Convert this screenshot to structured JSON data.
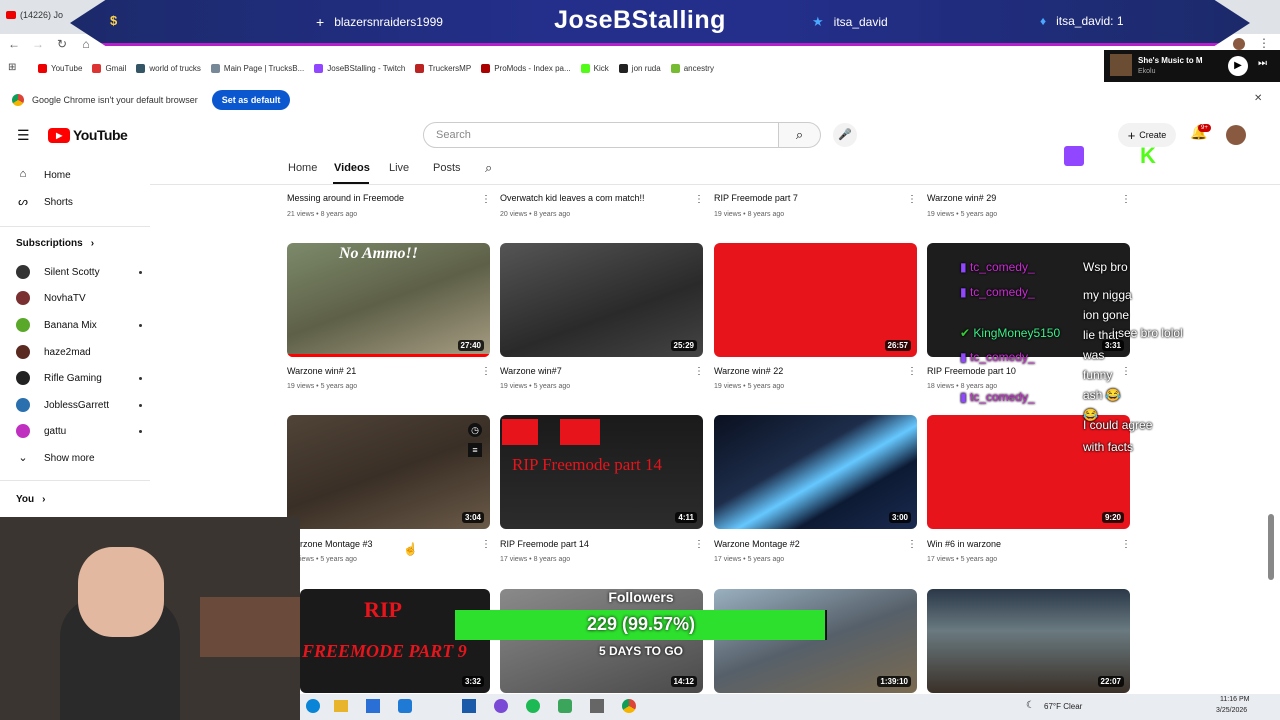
{
  "browser": {
    "tab_title": "(14226) Jo",
    "bookmarks": [
      "YouTube",
      "Gmail",
      "world of trucks",
      "Main Page | TrucksB...",
      "JoseBStalling - Twitch",
      "TruckersMP",
      "ProMods - Index pa...",
      "Kick",
      "jon ruda",
      "ancestry"
    ],
    "default_msg": "Google Chrome isn't your default browser",
    "set_default": "Set as default",
    "close": "✕"
  },
  "overlay": {
    "streamer": "JoseBStalling",
    "left_user": "blazersnraiders1999",
    "right_user": "itsa_david",
    "right_count": "itsa_david: 1",
    "colors": {
      "banner": "#232f8a",
      "accent": "#b620c9",
      "goal": "#2ee02e"
    }
  },
  "music": {
    "title": "She's Music to M",
    "artist": "Ekolu"
  },
  "youtube": {
    "logo": "YouTube",
    "search_placeholder": "Search",
    "create": "Create",
    "notif_badge": "9+",
    "sidebar": {
      "home": "Home",
      "shorts": "Shorts",
      "subs_header": "Subscriptions",
      "subs": [
        {
          "name": "Silent Scotty",
          "color": "#333"
        },
        {
          "name": "NovhaTV",
          "color": "#7a3030"
        },
        {
          "name": "Banana Mix",
          "color": "#5aa82a"
        },
        {
          "name": "haze2mad",
          "color": "#5a2a20"
        },
        {
          "name": "Rifle Gaming",
          "color": "#222"
        },
        {
          "name": "JoblessGarrett",
          "color": "#2a6fae"
        },
        {
          "name": "gattu",
          "color": "#c030c0"
        }
      ],
      "show_more": "Show more",
      "you": "You"
    },
    "tabs": [
      "Home",
      "Videos",
      "Live",
      "Posts"
    ],
    "row0": [
      {
        "title": "Messing around in Freemode",
        "meta": "21 views • 8 years ago"
      },
      {
        "title": "Overwatch kid leaves a com match!!",
        "meta": "20 views • 8 years ago"
      },
      {
        "title": "RIP Freemode part 7",
        "meta": "19 views • 8 years ago"
      },
      {
        "title": "Warzone win# 29",
        "meta": "19 views • 5 years ago"
      }
    ],
    "row1": [
      {
        "title": "Warzone win# 21",
        "meta": "19 views • 5 years ago",
        "dur": "27:40",
        "overlay": "No Ammo!!"
      },
      {
        "title": "Warzone win#7",
        "meta": "19 views • 5 years ago",
        "dur": "25:29"
      },
      {
        "title": "Warzone win# 22",
        "meta": "19 views • 5 years ago",
        "dur": "26:57"
      },
      {
        "title": "RIP Freemode part 10",
        "meta": "18 views • 8 years ago",
        "dur": "3:31"
      }
    ],
    "row2": [
      {
        "title": "rzone Montage #3",
        "meta": "iews • 5 years ago",
        "dur": "3:04"
      },
      {
        "title": "RIP Freemode part 14",
        "meta": "17 views • 8 years ago",
        "dur": "4:11",
        "overlay": "RIP Freemode part 14"
      },
      {
        "title": "Warzone Montage #2",
        "meta": "17 views • 5 years ago",
        "dur": "3:00"
      },
      {
        "title": "Win #6 in warzone",
        "meta": "17 views • 5 years ago",
        "dur": "9:20"
      }
    ],
    "row3": [
      {
        "dur": "3:32",
        "overlay1": "RIP",
        "overlay2": "FREEMODE PART 9"
      },
      {
        "dur": "14:12"
      },
      {
        "dur": "1:39:10"
      },
      {
        "dur": "22:07"
      }
    ]
  },
  "chat": [
    {
      "user": "tc_comedy_",
      "msg": "Wsp bro"
    },
    {
      "user": "tc_comedy_",
      "msg": "my nigga ion gone lie that was funny ash 😂 😂"
    },
    {
      "user": "KingMoney5150",
      "msg": "i see bro lolol"
    },
    {
      "user": "tc_comedy_",
      "msg": ""
    },
    {
      "user": "tc_comedy_",
      "msg": "I could agree with facts"
    }
  ],
  "goal": {
    "label": "Followers",
    "value": "229 (99.57%)",
    "fill": 0.9957,
    "days": "5 DAYS TO GO"
  },
  "taskbar": {
    "weather": "67°F  Clear",
    "time": "11:16 PM",
    "date": "3/25/2026"
  }
}
